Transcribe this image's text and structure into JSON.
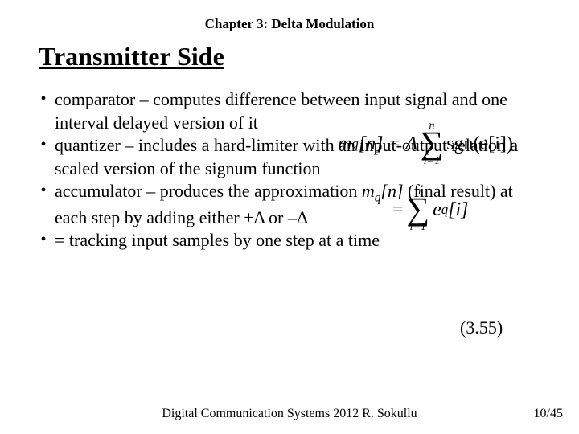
{
  "chapter": "Chapter 3: Delta Modulation",
  "title": "Transmitter Side",
  "bullets": {
    "b1": "comparator – computes difference between input signal and one interval delayed version of it",
    "b2": "quantizer – includes a hard-limiter with an input-output relation a scaled version of the signum function",
    "b3_pre": "accumulator – produces the approximation ",
    "b3_mq": "m",
    "b3_sub": "q",
    "b3_n": "[n]",
    "b3_post": " (final result) at each step by adding either +Δ or –Δ",
    "b4": "= tracking input samples by one step at a time"
  },
  "eq1": {
    "lhs_m": "m",
    "lhs_q": "q",
    "lhs_n": "[n] = Δ",
    "sum_top": "n",
    "sum_bot": "i=1",
    "rhs": "sgn(e[i])"
  },
  "eq2": {
    "lhs": "= ",
    "sum_top": "n",
    "sum_bot": "i=1",
    "e": "e",
    "q": "q",
    "i": "[i]"
  },
  "eqnum": "(3.55)",
  "footer": "Digital Communication Systems 2012 R. Sokullu",
  "pagenum": "10/45"
}
